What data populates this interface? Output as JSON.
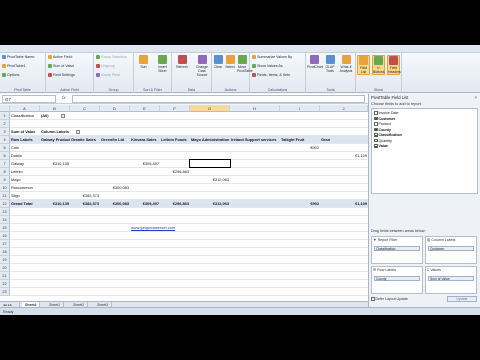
{
  "ribbon": {
    "groups": [
      {
        "label": "PivotTable",
        "items": [
          "PivotTable Name:",
          "PivotTable1",
          "Options"
        ]
      },
      {
        "label": "Active Field",
        "items": [
          "Active Field:",
          "Sum of Value",
          "Field Settings"
        ]
      },
      {
        "label": "Group",
        "items": [
          "Group Selection",
          "Ungroup",
          "Group Field"
        ]
      },
      {
        "label": "Sort & Filter",
        "items": [
          "Sort",
          "Insert Slicer"
        ]
      },
      {
        "label": "Data",
        "items": [
          "Refresh",
          "Change Data Source"
        ]
      },
      {
        "label": "Actions",
        "items": [
          "Clear",
          "Select",
          "Move PivotTable"
        ]
      },
      {
        "label": "Calculations",
        "items": [
          "Summarize Values By",
          "Show Values As",
          "Fields, Items, & Sets"
        ]
      },
      {
        "label": "Tools",
        "items": [
          "PivotChart",
          "OLAP Tools",
          "What-If Analysis"
        ]
      },
      {
        "label": "Show",
        "items": [
          "Field List",
          "+/- Buttons",
          "Field Headers"
        ]
      }
    ]
  },
  "formula_bar": {
    "name_box": "G7",
    "fx": "fx",
    "value": ""
  },
  "columns": [
    "A",
    "B",
    "C",
    "D",
    "E",
    "F",
    "G",
    "H",
    "I",
    "J"
  ],
  "rows": [
    "1",
    "2",
    "3",
    "4",
    "5",
    "6",
    "7",
    "8",
    "9",
    "10",
    "11",
    "12",
    "13",
    "14",
    "15",
    "16",
    "17",
    "18",
    "19",
    "20",
    "21",
    "22",
    "23"
  ],
  "pivot": {
    "filter_label": "Classification",
    "filter_value": "(All)",
    "sum_label": "Sum of Value",
    "column_labels": "Column Labels",
    "row_labels": "Row Labels",
    "headers": [
      "Galway Products",
      "Granite Sales",
      "Greenfin Ltd",
      "Kinvara Sales",
      "Leitrim Foods",
      "Mayo Administration",
      "Ireland Support services",
      "Tailight Fruit",
      "Gran"
    ],
    "rows": [
      {
        "label": "Cork",
        "values": [
          "",
          "",
          "",
          "",
          "",
          "",
          "",
          "€902",
          ""
        ]
      },
      {
        "label": "Dublin",
        "values": [
          "",
          "",
          "",
          "",
          "",
          "",
          "",
          "",
          "€1,109"
        ]
      },
      {
        "label": "Galway",
        "values": [
          "€310,135",
          "",
          "",
          "€305,497",
          "",
          "",
          "",
          "",
          ""
        ]
      },
      {
        "label": "Leitrim",
        "values": [
          "",
          "",
          "",
          "",
          "€296,863",
          "",
          "",
          "",
          ""
        ]
      },
      {
        "label": "Mayo",
        "values": [
          "",
          "",
          "",
          "",
          "",
          "€312,063",
          "",
          "",
          ""
        ]
      },
      {
        "label": "Roscommon",
        "values": [
          "",
          "",
          "€300,083",
          "",
          "",
          "",
          "",
          "",
          ""
        ]
      },
      {
        "label": "Sligo",
        "values": [
          "",
          "€382,373",
          "",
          "",
          "",
          "",
          "",
          "",
          ""
        ]
      }
    ],
    "grand_total_label": "Grand Total",
    "grand_totals": [
      "€310,135",
      "€382,373",
      "€300,083",
      "€305,497",
      "€296,863",
      "€312,063",
      "",
      "€902",
      "€1,109"
    ]
  },
  "link_text": "www.getgoodatexcel.com",
  "sheets": [
    "Sheet4",
    "Sheet1",
    "Sheet2",
    "Sheet3"
  ],
  "active_sheet": "Sheet4",
  "status": "Ready",
  "pane": {
    "title": "PivotTable Field List",
    "close": "×",
    "choose_label": "Choose fields to add to report:",
    "fields": [
      {
        "name": "Invoice Date",
        "checked": false,
        "bold": false
      },
      {
        "name": "Customer",
        "checked": true,
        "bold": true
      },
      {
        "name": "Product",
        "checked": false,
        "bold": false
      },
      {
        "name": "County",
        "checked": true,
        "bold": true
      },
      {
        "name": "Classification",
        "checked": true,
        "bold": true
      },
      {
        "name": "Quantity",
        "checked": false,
        "bold": false
      },
      {
        "name": "Value",
        "checked": true,
        "bold": true
      }
    ],
    "drag_label": "Drag fields between areas below:",
    "areas": [
      {
        "title": "Report Filter",
        "chip": "Classification"
      },
      {
        "title": "Column Labels",
        "chip": "Customer"
      },
      {
        "title": "Row Labels",
        "chip": "County"
      },
      {
        "title": "Values",
        "chip": "Sum of Value"
      }
    ],
    "defer_label": "Defer Layout Update",
    "update_label": "Update"
  }
}
